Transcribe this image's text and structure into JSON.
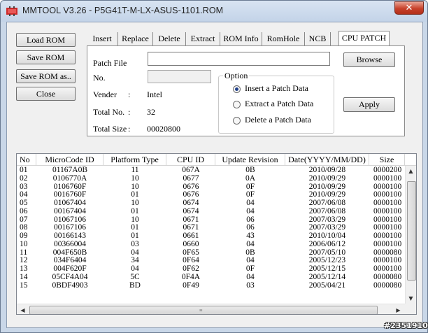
{
  "window": {
    "title": "MMTOOL V3.26 - P5G41T-M-LX-ASUS-1101.ROM",
    "close_glyph": "✕"
  },
  "side_buttons": [
    "Load ROM",
    "Save ROM",
    "Save ROM as..",
    "Close"
  ],
  "tabs": [
    "Insert",
    "Replace",
    "Delete",
    "Extract",
    "ROM Info",
    "RomHole",
    "NCB",
    "CPU PATCH"
  ],
  "active_tab": "CPU PATCH",
  "patch": {
    "patch_file_label": "Patch File",
    "patch_file_value": "",
    "no_label": "No.",
    "no_value": "",
    "vender_label": "Vender",
    "vender_value": "Intel",
    "total_no_label": "Total No.",
    "total_no_value": "32",
    "total_size_label": "Total Size",
    "total_size_value": "00020800",
    "colon": ":",
    "browse_label": "Browse",
    "apply_label": "Apply"
  },
  "option": {
    "title": "Option",
    "choices": [
      "Insert a Patch Data",
      "Extract a Patch Data",
      "Delete a Patch Data"
    ],
    "selected": "Insert a Patch Data"
  },
  "table": {
    "columns": [
      "No",
      "MicroCode ID",
      "Platform Type",
      "CPU ID",
      "Update Revision",
      "Date(YYYY/MM/DD)",
      "Size"
    ],
    "rows": [
      [
        "01",
        "01167A0B",
        "11",
        "067A",
        "0B",
        "2010/09/28",
        "0000200"
      ],
      [
        "02",
        "0106770A",
        "10",
        "0677",
        "0A",
        "2010/09/29",
        "0000100"
      ],
      [
        "03",
        "0106760F",
        "10",
        "0676",
        "0F",
        "2010/09/29",
        "0000100"
      ],
      [
        "04",
        "0016760F",
        "01",
        "0676",
        "0F",
        "2010/09/29",
        "0000100"
      ],
      [
        "05",
        "01067404",
        "10",
        "0674",
        "04",
        "2007/06/08",
        "0000100"
      ],
      [
        "06",
        "00167404",
        "01",
        "0674",
        "04",
        "2007/06/08",
        "0000100"
      ],
      [
        "07",
        "01067106",
        "10",
        "0671",
        "06",
        "2007/03/29",
        "0000100"
      ],
      [
        "08",
        "00167106",
        "01",
        "0671",
        "06",
        "2007/03/29",
        "0000100"
      ],
      [
        "09",
        "00166143",
        "01",
        "0661",
        "43",
        "2010/10/04",
        "0000100"
      ],
      [
        "10",
        "00366004",
        "03",
        "0660",
        "04",
        "2006/06/12",
        "0000100"
      ],
      [
        "11",
        "004F650B",
        "04",
        "0F65",
        "0B",
        "2007/05/10",
        "0000080"
      ],
      [
        "12",
        "034F6404",
        "34",
        "0F64",
        "04",
        "2005/12/23",
        "0000100"
      ],
      [
        "13",
        "004F620F",
        "04",
        "0F62",
        "0F",
        "2005/12/15",
        "0000100"
      ],
      [
        "14",
        "05CF4A04",
        "5C",
        "0F4A",
        "04",
        "2005/12/14",
        "0000080"
      ],
      [
        "15",
        "0BDF4903",
        "BD",
        "0F49",
        "03",
        "2005/04/21",
        "0000080"
      ]
    ]
  },
  "watermark": "#2351910",
  "icons": {
    "app": "mmtool-app-icon",
    "scroll_up": "▲",
    "scroll_down": "▼",
    "scroll_left": "◀",
    "scroll_right": "▶",
    "grip": "≡"
  },
  "colors": {
    "title_bg": "#c9d7e8",
    "close_btn": "#c7402a",
    "radio_dot": "#1f3f8a"
  }
}
